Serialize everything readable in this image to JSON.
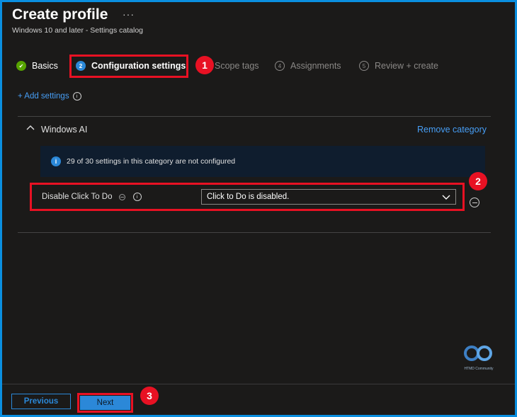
{
  "header": {
    "title": "Create profile",
    "more_label": "···",
    "subtitle": "Windows 10 and later - Settings catalog"
  },
  "steps": [
    {
      "number": "✔",
      "label": "Basics",
      "state": "done"
    },
    {
      "number": "2",
      "label": "Configuration settings",
      "state": "current"
    },
    {
      "number": "3",
      "label": "Scope tags",
      "state": "pending"
    },
    {
      "number": "4",
      "label": "Assignments",
      "state": "pending"
    },
    {
      "number": "5",
      "label": "Review + create",
      "state": "pending"
    }
  ],
  "add_settings_label": "+ Add settings",
  "category": {
    "name": "Windows AI",
    "remove_label": "Remove category",
    "info_text": "29 of 30 settings in this category are not configured"
  },
  "setting": {
    "label": "Disable Click To Do",
    "value": "Click to Do is disabled."
  },
  "annotations": [
    "1",
    "2",
    "3"
  ],
  "logo_text": "HTMD Community",
  "footer": {
    "previous_label": "Previous",
    "next_label": "Next"
  },
  "colors": {
    "accent": "#2b88d8",
    "link": "#479ef5",
    "highlight": "#e81123",
    "success": "#57a300",
    "background": "#1b1a19"
  }
}
